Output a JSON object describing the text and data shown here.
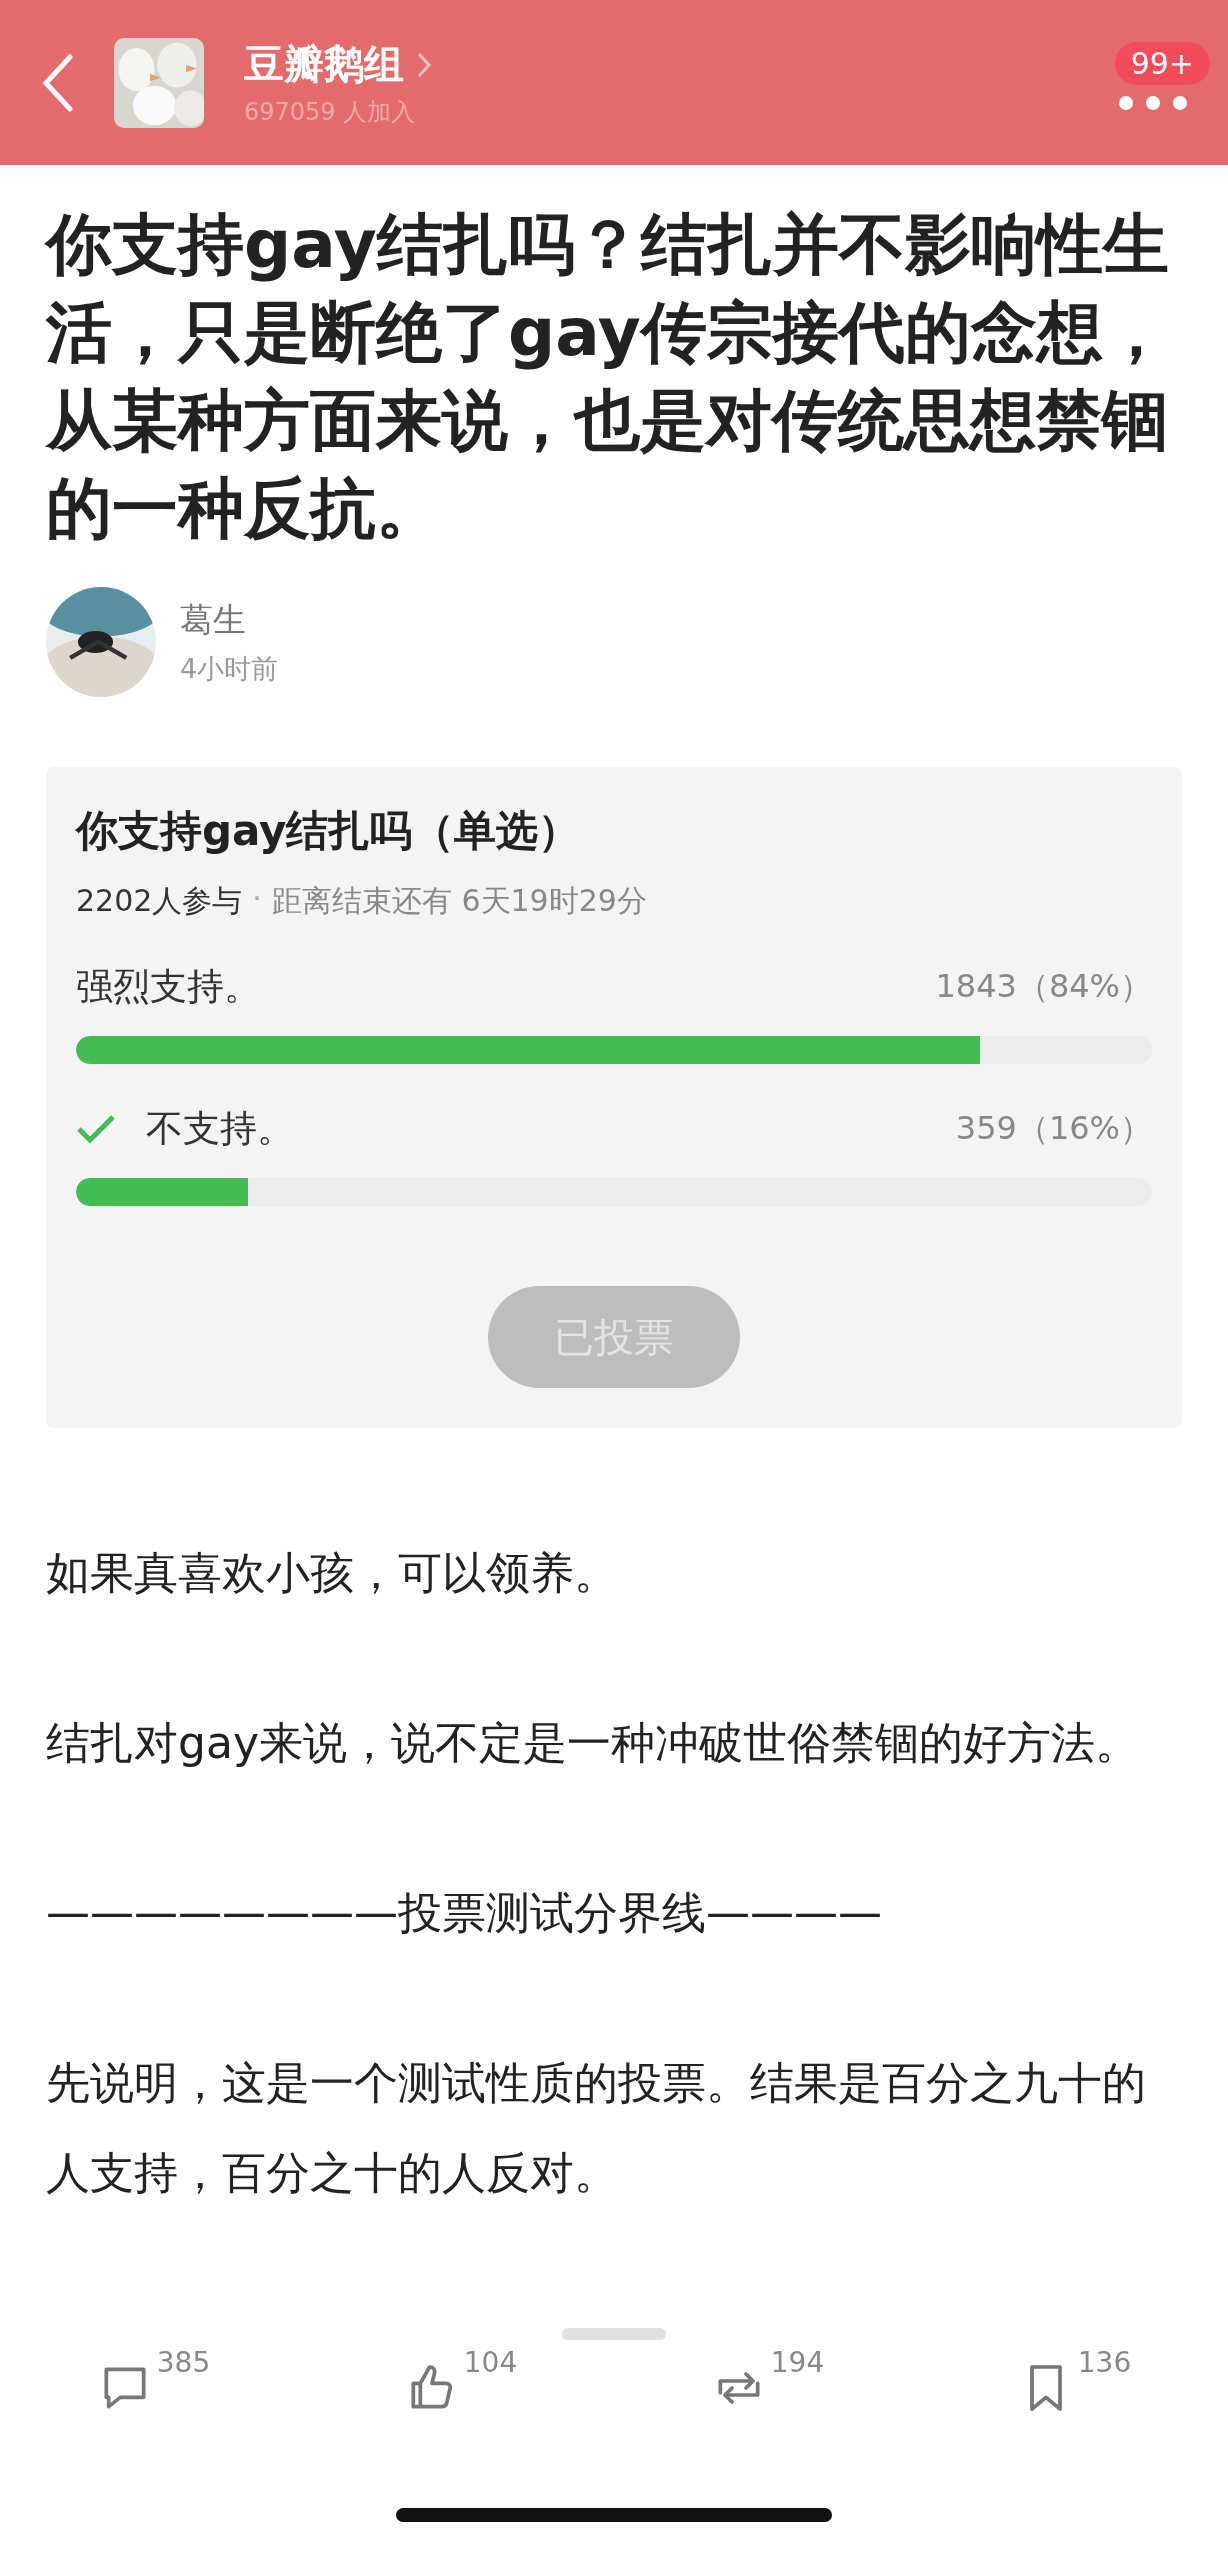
{
  "header": {
    "group_name": "豆瓣鹅组",
    "members": "697059 人加入",
    "badge": "99+"
  },
  "post": {
    "title": "你支持gay结扎吗？结扎并不影响性生活，只是断绝了gay传宗接代的念想，从某种方面来说，也是对传统思想禁锢的一种反抗。",
    "author": {
      "name": "葛生",
      "time": "4小时前"
    }
  },
  "poll": {
    "title": "你支持gay结扎吗（单选）",
    "participants": "2202人参与",
    "separator": "·",
    "remaining": "距离结束还有 6天19时29分",
    "options": [
      {
        "label": "强烈支持。",
        "result": "1843（84%）",
        "level": 0.84,
        "selected": false
      },
      {
        "label": "不支持。",
        "result": "359（16%）",
        "level": 0.16,
        "selected": true
      }
    ],
    "button": {
      "label": "已投票",
      "disabled": true
    }
  },
  "paragraphs": [
    "如果真喜欢小孩，可以领养。",
    "结扎对gay来说，说不定是一种冲破世俗禁锢的好方法。",
    "————————投票测试分界线————",
    "先说明，这是一个测试性质的投票。结果是百分之九十的人支持，百分之十的人反对。"
  ],
  "actions": [
    {
      "kind": "comment",
      "count": "385"
    },
    {
      "kind": "like",
      "count": "104"
    },
    {
      "kind": "repost",
      "count": "194"
    },
    {
      "kind": "bookmark",
      "count": "136"
    }
  ]
}
